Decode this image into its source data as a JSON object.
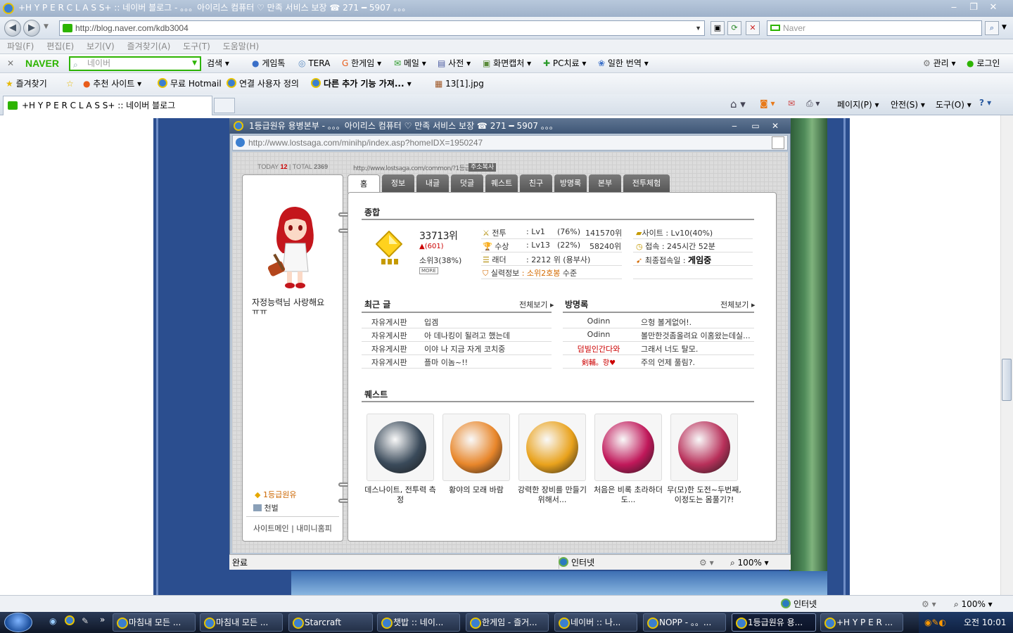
{
  "window": {
    "title": "+H Y P E R C L A S S+ :: 네이버 블로그 - 。。。아이리스 컴퓨터 ♡ 만족 서비스 보장 ☎ 271 ━ 5907 。。。"
  },
  "address": {
    "url": "http://blog.naver.com/kdb3004",
    "search_placeholder": "Naver"
  },
  "menu": [
    "파일(F)",
    "편집(E)",
    "보기(V)",
    "즐겨찾기(A)",
    "도구(T)",
    "도움말(H)"
  ],
  "naver_toolbar": {
    "logo": "NAVER",
    "search_placeholder": "네이버",
    "search_btn": "검색",
    "items": [
      "게임톡",
      "TERA",
      "한게임",
      "메일",
      "사전",
      "화면캡처",
      "PC치료",
      "일한 번역"
    ],
    "manage": "관리",
    "login": "로그인"
  },
  "favorites": {
    "label": "즐겨찾기",
    "items": [
      "추천 사이트",
      "무료 Hotmail",
      "연결 사용자 정의",
      "다른 추가 기능 가져...",
      "13[1].jpg"
    ]
  },
  "tab": {
    "title": "+H Y P E R C L A S S+ :: 네이버 블로그"
  },
  "command_bar": [
    "페이지(P)",
    "안전(S)",
    "도구(O)"
  ],
  "popup": {
    "title": "1등급원유 용병본부 - 。。。아이리스 컴퓨터 ♡ 만족 서비스 보장 ☎ 271 ━ 5907 。。。",
    "url": "http://www.lostsaga.com/minihp/index.asp?homeIDX=1950247",
    "status": "완료",
    "zone": "인터넷",
    "zoom": "100%"
  },
  "minihp": {
    "today_label": "TODAY",
    "today": "12",
    "total_label": "TOTAL",
    "total": "2369",
    "hp_url": "http://www.lostsaga.com/common/?1등급원유",
    "copy_btn": "주소복사",
    "tabs": [
      "홈",
      "정보",
      "내글",
      "덧글",
      "퀘스트",
      "친구",
      "방명록",
      "본부",
      "전투체험"
    ],
    "profile_msg": "자정능력님 사랑해요 ㅠㅠ",
    "nick": "1등급원유",
    "rank": "천벌",
    "links": "사이트메인 | 내미니홈피",
    "summary_title": "종합",
    "rank_value": "33713위",
    "rank_change": "▲(601)",
    "class": "소위3(38%)",
    "more": "MORE",
    "stats": [
      {
        "label": "전투",
        "lv": ": Lv1",
        "pct": "(76%)",
        "rank": "141570위"
      },
      {
        "label": "수상",
        "lv": ": Lv13",
        "pct": "(22%)",
        "rank": "58240위"
      },
      {
        "label": "래더",
        "lv": ": 2212 위 (용부사)",
        "pct": "",
        "rank": ""
      }
    ],
    "skill_label": "실력정보",
    "skill_value": ": 소위2호봉",
    "skill_suffix": "수준",
    "site_label": "사이트",
    "site_value": ": Lv10(40%)",
    "conn_label": "접속",
    "conn_value": ": 245시간 52분",
    "last_label": "최종접속일",
    "last_value": "게임중",
    "recent_title": "최근 글",
    "guest_title": "방명록",
    "view_all": "전체보기",
    "posts": [
      {
        "board": "자유게시판",
        "title": "입겜"
      },
      {
        "board": "자유게시판",
        "title": "아 데나킹이 될려고 했는데"
      },
      {
        "board": "자유게시판",
        "title": "이야 나 지금 자게 코치중"
      },
      {
        "board": "자유게시판",
        "title": "플마 이놈~!!"
      }
    ],
    "guestbook": [
      {
        "name": "Odinn",
        "msg": "으헝 볼게없어!."
      },
      {
        "name": "Odinn",
        "msg": "볼만한것좀올려요 이홈왔는데실..."
      },
      {
        "name": "덤빌인간다와",
        "msg": "그래서 너도 탈모."
      },
      {
        "name": "剣輔。향♥",
        "msg": "주의 언제 풀림?."
      }
    ],
    "quest_title": "퀘스트",
    "quests": [
      {
        "label": "데스나이트, 전투력 측정",
        "color": "#3a4a5a"
      },
      {
        "label": "황야의 모래 바람",
        "color": "#e8862a"
      },
      {
        "label": "강력한 장비를 만들기 위해서...",
        "color": "#e9a21c"
      },
      {
        "label": "처음은 비록 초라하더도...",
        "color": "#c0185a"
      },
      {
        "label": "무(모)한 도전~두번째, 이정도는 몸풀기?!",
        "color": "#b8305a"
      }
    ]
  },
  "status": {
    "zone": "인터넷",
    "zoom": "100%"
  },
  "taskbar": {
    "items": [
      "마침내 모든 ...",
      "마침내 모든 ...",
      "Starcraft",
      "챗밥 :: 네이...",
      "한게임 - 즐거...",
      "네이버 :: 나...",
      "NOPP - 。。...",
      "1등급원유 용...",
      "+H Y P E R ..."
    ],
    "clock": "오전 10:01"
  }
}
